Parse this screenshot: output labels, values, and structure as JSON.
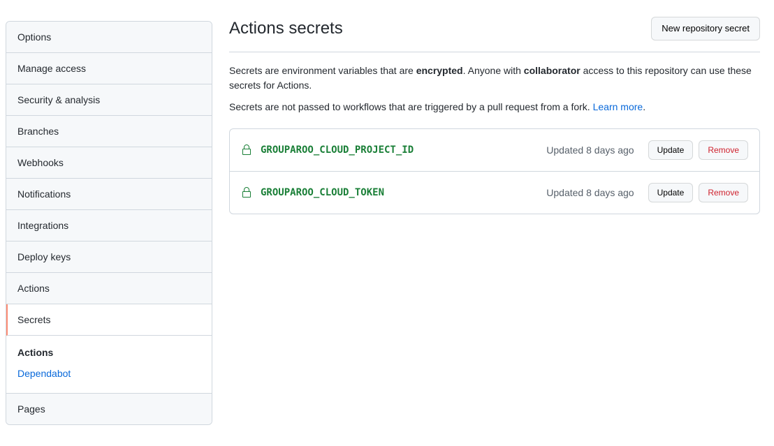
{
  "sidebar": {
    "items": [
      {
        "label": "Options"
      },
      {
        "label": "Manage access"
      },
      {
        "label": "Security & analysis"
      },
      {
        "label": "Branches"
      },
      {
        "label": "Webhooks"
      },
      {
        "label": "Notifications"
      },
      {
        "label": "Integrations"
      },
      {
        "label": "Deploy keys"
      },
      {
        "label": "Actions"
      },
      {
        "label": "Secrets"
      }
    ],
    "sub": {
      "title": "Actions",
      "link": "Dependabot"
    },
    "pages": "Pages"
  },
  "main": {
    "title": "Actions secrets",
    "new_secret_button": "New repository secret",
    "desc1_a": "Secrets are environment variables that are ",
    "desc1_b": "encrypted",
    "desc1_c": ". Anyone with ",
    "desc1_d": "collaborator",
    "desc1_e": " access to this repository can use these secrets for Actions.",
    "desc2_a": "Secrets are not passed to workflows that are triggered by a pull request from a fork. ",
    "desc2_link": "Learn more",
    "desc2_b": "."
  },
  "secrets": [
    {
      "name": "GROUPAROO_CLOUD_PROJECT_ID",
      "updated": "Updated 8 days ago"
    },
    {
      "name": "GROUPAROO_CLOUD_TOKEN",
      "updated": "Updated 8 days ago"
    }
  ],
  "buttons": {
    "update": "Update",
    "remove": "Remove"
  }
}
